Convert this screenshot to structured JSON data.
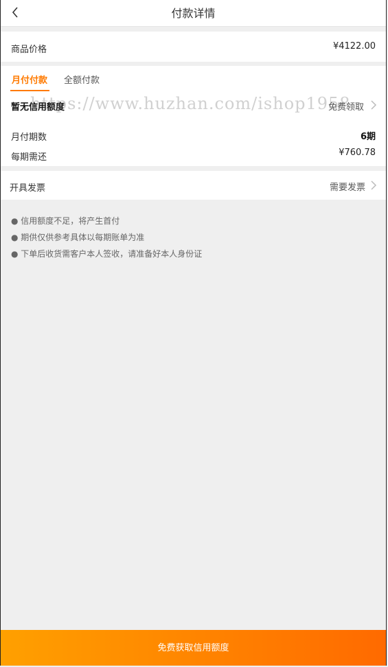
{
  "header": {
    "title": "付款详情"
  },
  "price": {
    "label": "商品价格",
    "value": "¥4122.00"
  },
  "tabs": [
    {
      "label": "月付付款",
      "active": true
    },
    {
      "label": "全额付款",
      "active": false
    }
  ],
  "credit": {
    "label": "暂无信用额度",
    "action": "免费领取"
  },
  "installments": {
    "label": "月付期数",
    "value": "6期"
  },
  "per_period": {
    "label": "每期需还",
    "value": "¥760.78"
  },
  "invoice": {
    "label": "开具发票",
    "action": "需要发票"
  },
  "notes": [
    "● 信用额度不足，将产生首付",
    "● 期供仅供参考具体以每期账单为准",
    "● 下单后收货需客户本人签收，请准备好本人身份证"
  ],
  "watermark": "https://www.huzhan.com/ishop1958",
  "footer": {
    "button_label": "免费获取信用额度"
  },
  "colors": {
    "accent": "#ff7a00",
    "gradient_start": "#ffa000",
    "gradient_end": "#ff6a00"
  }
}
